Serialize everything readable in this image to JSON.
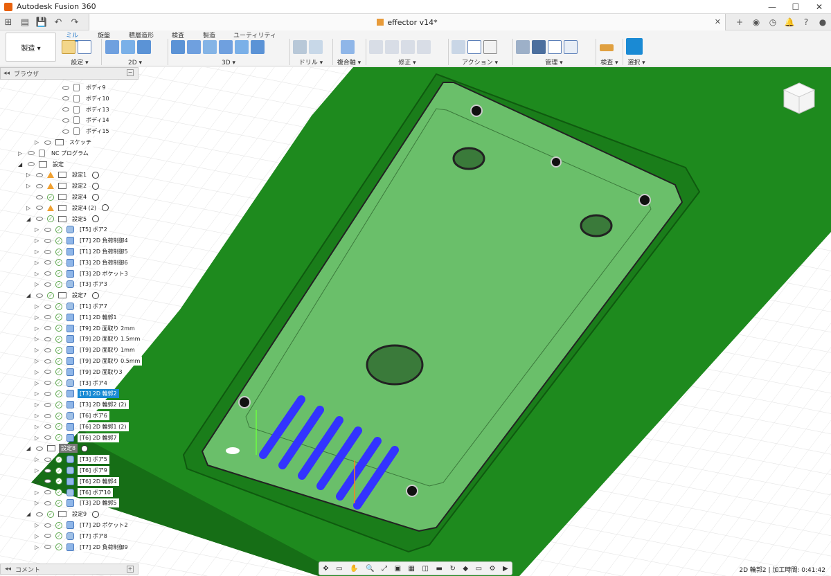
{
  "app": {
    "title": "Autodesk Fusion 360"
  },
  "document": {
    "tab_title": "effector v14*"
  },
  "workspace": {
    "label": "製造 ▾"
  },
  "ribbon": {
    "tabs": [
      "ミル",
      "旋盤",
      "積層造形",
      "検査",
      "製造",
      "ユーティリティ"
    ],
    "groups": [
      "設定 ▾",
      "2D ▾",
      "3D ▾",
      "ドリル ▾",
      "複合軸 ▾",
      "修正 ▾",
      "アクション ▾",
      "管理 ▾",
      "検査 ▾",
      "選択 ▾"
    ]
  },
  "browser": {
    "title": "ブラウザ",
    "comment_title": "コメント"
  },
  "tree": [
    {
      "label": "ボディ9"
    },
    {
      "label": "ボディ10"
    },
    {
      "label": "ボディ13"
    },
    {
      "label": "ボディ14"
    },
    {
      "label": "ボディ15"
    },
    {
      "label": "スケッチ"
    },
    {
      "label": "NC プログラム"
    },
    {
      "label": "設定"
    },
    {
      "label": "設定1"
    },
    {
      "label": "設定2"
    },
    {
      "label": "設定4"
    },
    {
      "label": "設定4 (2)"
    },
    {
      "label": "設定5"
    },
    {
      "label": "[T5] ボア2"
    },
    {
      "label": "[T7] 2D 負荷制御4"
    },
    {
      "label": "[T1] 2D 負荷制御5"
    },
    {
      "label": "[T3] 2D 負荷制御6"
    },
    {
      "label": "[T3] 2D ポケット3"
    },
    {
      "label": "[T3] ボア3"
    },
    {
      "label": "設定7"
    },
    {
      "label": "[T1] ボア7"
    },
    {
      "label": "[T1] 2D 輪郭1"
    },
    {
      "label": "[T9] 2D 面取り 2mm"
    },
    {
      "label": "[T9] 2D 面取り 1.5mm"
    },
    {
      "label": "[T9] 2D 面取り 1mm"
    },
    {
      "label": "[T9] 2D 面取り 0.5mm"
    },
    {
      "label": "[T9] 2D 面取り3"
    },
    {
      "label": "[T3] ボア4"
    },
    {
      "label": "[T3] 2D 輪郭2"
    },
    {
      "label": "[T3] 2D 輪郭2 (2)"
    },
    {
      "label": "[T6] ボア6"
    },
    {
      "label": "[T6] 2D 輪郭1 (2)"
    },
    {
      "label": "[T6] 2D 輪郭7"
    },
    {
      "label": "設定8"
    },
    {
      "label": "[T3] ボア5"
    },
    {
      "label": "[T6] ボア9"
    },
    {
      "label": "[T6] 2D 輪郭4"
    },
    {
      "label": "[T6] ボア10"
    },
    {
      "label": "[T3] 2D 輪郭5"
    },
    {
      "label": "設定9"
    },
    {
      "label": "[T7] 2D ポケット2"
    },
    {
      "label": "[T7] ボア8"
    },
    {
      "label": "[T7] 2D 負荷制御9"
    }
  ],
  "status": {
    "text": "2D 輪郭2 | 加工時間: 0:41:42"
  },
  "colors": {
    "accent": "#1a8ad4",
    "stock_green": "#1e8a1e",
    "part_green": "#5aad5a",
    "toolpath_blue": "#3c3cff"
  }
}
